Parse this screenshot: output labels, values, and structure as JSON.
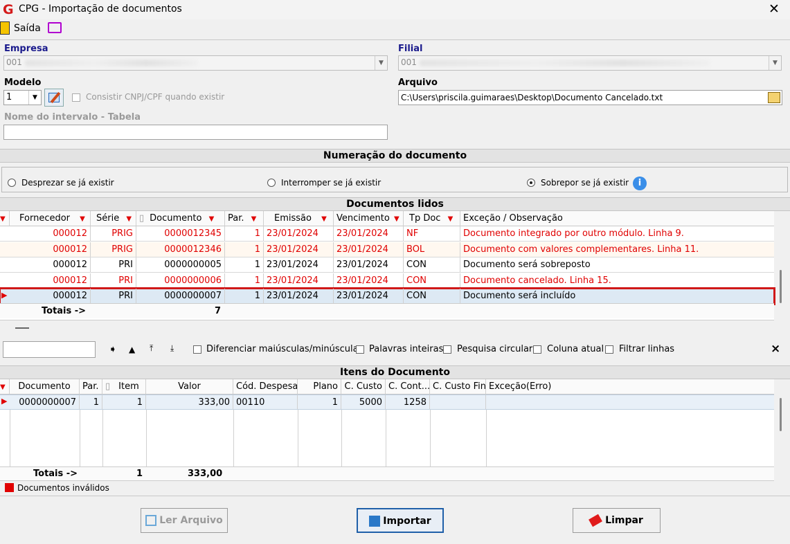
{
  "window": {
    "title": "CPG - Importação de documentos",
    "logo": "G"
  },
  "toolbar": {
    "exit_label": "Saída"
  },
  "form": {
    "empresa_label": "Empresa",
    "empresa_value": "001",
    "filial_label": "Filial",
    "filial_value": "001",
    "modelo_label": "Modelo",
    "modelo_value": "1",
    "consistir_label": "Consistir CNPJ/CPF quando existir",
    "arquivo_label": "Arquivo",
    "arquivo_value": "C:\\Users\\priscila.guimaraes\\Desktop\\Documento Cancelado.txt",
    "intervalo_label": "Nome do intervalo - Tabela",
    "intervalo_value": ""
  },
  "numeracao": {
    "title": "Numeração do documento",
    "options": [
      "Desprezar se já existir",
      "Interromper se já existir",
      "Sobrepor se já existir"
    ],
    "selected": "Sobrepor se já existir"
  },
  "docs": {
    "title": "Documentos lidos",
    "columns": [
      "Fornecedor",
      "Série",
      "Documento",
      "Par.",
      "Emissão",
      "Vencimento",
      "Tp Doc",
      "Exceção / Observação"
    ],
    "rows": [
      {
        "fornecedor": "000012",
        "serie": "PRIG",
        "documento": "0000012345",
        "par": "1",
        "emissao": "23/01/2024",
        "vencimento": "23/01/2024",
        "tpdoc": "NF",
        "obs": "Documento integrado por outro módulo. Linha 9.",
        "invalid": true
      },
      {
        "fornecedor": "000012",
        "serie": "PRIG",
        "documento": "0000012346",
        "par": "1",
        "emissao": "23/01/2024",
        "vencimento": "23/01/2024",
        "tpdoc": "BOL",
        "obs": "Documento com valores complementares. Linha 11.",
        "invalid": true
      },
      {
        "fornecedor": "000012",
        "serie": "PRI",
        "documento": "0000000005",
        "par": "1",
        "emissao": "23/01/2024",
        "vencimento": "23/01/2024",
        "tpdoc": "CON",
        "obs": "Documento será sobreposto",
        "invalid": false
      },
      {
        "fornecedor": "000012",
        "serie": "PRI",
        "documento": "0000000006",
        "par": "1",
        "emissao": "23/01/2024",
        "vencimento": "23/01/2024",
        "tpdoc": "CON",
        "obs": "Documento cancelado. Linha 15.",
        "invalid": true
      },
      {
        "fornecedor": "000012",
        "serie": "PRI",
        "documento": "0000000007",
        "par": "1",
        "emissao": "23/01/2024",
        "vencimento": "23/01/2024",
        "tpdoc": "CON",
        "obs": "Documento será incluído",
        "invalid": false,
        "selected": true
      }
    ],
    "totals_label": "Totais ->",
    "totals_value": "7"
  },
  "search": {
    "value": "",
    "options": [
      "Diferenciar maiúsculas/minúsculas",
      "Palavras inteiras",
      "Pesquisa circular",
      "Coluna atual",
      "Filtrar linhas"
    ],
    "close": "×"
  },
  "itens": {
    "title": "Itens do Documento",
    "columns": [
      "Documento",
      "Par.",
      "Item",
      "Valor",
      "Cód. Despesa",
      "Plano",
      "C. Custo",
      "C. Cont...",
      "C. Custo Fin.",
      "Exceção(Erro)"
    ],
    "rows": [
      {
        "documento": "0000000007",
        "par": "1",
        "item": "1",
        "valor": "333,00",
        "despesa": "00110",
        "plano": "1",
        "ccusto": "5000",
        "ccont": "1258",
        "ccustofin": "",
        "excecao": ""
      }
    ],
    "totals_label": "Totais ->",
    "totals_item": "1",
    "totals_valor": "333,00"
  },
  "legend": {
    "invalid_label": "Documentos inválidos",
    "invalid_color": "#e00000"
  },
  "buttons": {
    "ler": "Ler Arquivo",
    "importar": "Importar",
    "limpar": "Limpar"
  }
}
